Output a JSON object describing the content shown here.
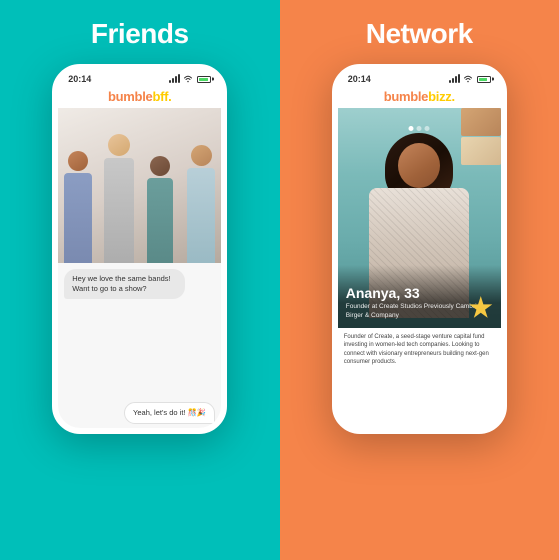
{
  "left_panel": {
    "background_color": "#00BFB9",
    "title": "Friends",
    "phone": {
      "status_time": "20:14",
      "app_name": "bumble",
      "app_mode": "bff.",
      "photo_alt": "Group of friends",
      "chat_messages": [
        {
          "side": "left",
          "text": "Hey we love the same bands! Want to go to a show?"
        },
        {
          "side": "right",
          "text": "Yeah, let's do it! 🎊🎉"
        }
      ]
    }
  },
  "right_panel": {
    "background_color": "#F5844A",
    "title": "Network",
    "phone": {
      "status_time": "20:14",
      "app_name": "bumble",
      "app_mode": "bizz.",
      "profile_name": "Ananya, 33",
      "profile_title": "Founder at Create Studios\nPreviously Cambrio, Birger &\nCompany",
      "profile_description": "Founder of Create, a seed-stage venture capital fund investing in women-led tech companies. Looking to connect with visionary entrepreneurs building next-gen consumer products.",
      "dots": [
        "active",
        "inactive",
        "inactive"
      ]
    }
  }
}
